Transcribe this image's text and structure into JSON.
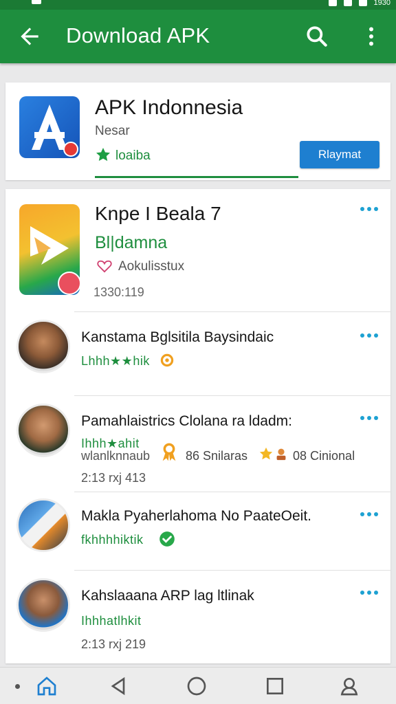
{
  "status_bar": {
    "time": "1930"
  },
  "appbar": {
    "title": "Download APK",
    "back_icon": "arrow-back-icon",
    "search_icon": "search-icon",
    "more_icon": "more-vert-icon"
  },
  "colors": {
    "primary": "#1e8e3e",
    "accent_blue": "#1e7fd0",
    "dots_blue": "#1da1d2",
    "background": "#e9e9ea"
  },
  "featured_app": {
    "title": "APK Indonnesia",
    "subtitle": "Nesar",
    "rating": "loaiba",
    "button_label": "Rlaymat",
    "download_progress": 0.55
  },
  "detail": {
    "title": "Knpe I Beala 7",
    "status": "Bl|damna",
    "sub_label": "Aokulisstux",
    "date": "1330:119"
  },
  "list": [
    {
      "title": "Kanstama Bglsitila Baysindaic",
      "stars_text": "Lhhh★★hik",
      "badge_icon": "settings-badge-icon",
      "date": ""
    },
    {
      "title": "Pamahlaistrics Clolana ra ldadm:",
      "stars_text": "Ihhh★ahit",
      "line2_text": "wlanlknnaub",
      "count_text": "86 Snilaras",
      "count2_text": "08 Cinional",
      "date": "2:13 rxj 413"
    },
    {
      "title": "Makla Pyaherlahoma No PaateOeit.",
      "stars_text": "fkhhhhiktik",
      "badge_icon": "verified-badge-icon",
      "date": ""
    },
    {
      "title": "Kahslaaana ARP lag ltlinak",
      "stars_text": "Ihhhatlhkit",
      "date": "2:13 rxj 219"
    }
  ],
  "bottom_nav": [
    "home-icon",
    "back-triangle-icon",
    "home-circle-icon",
    "recents-square-icon",
    "account-icon"
  ]
}
